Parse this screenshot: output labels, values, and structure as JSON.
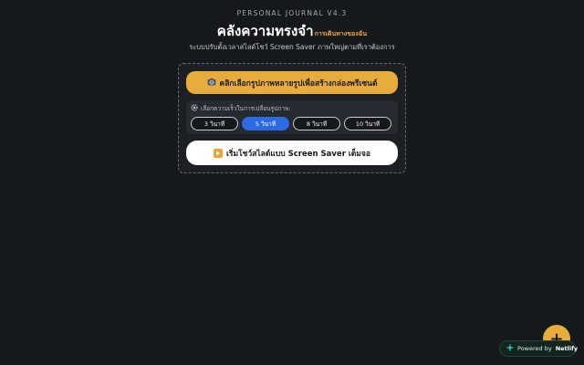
{
  "header": {
    "kicker": "PERSONAL JOURNAL V4.3",
    "title": "คลังความทรงจำ",
    "title_sub": "การเดินทางของฉัน",
    "description": "ระบบปรับตั้งเวลาสไลด์โชว์ Screen Saver ภาพใหญ่ตามที่เราต้องการ"
  },
  "panel": {
    "pick_button": {
      "icon": "camera-icon",
      "label": "คลิกเลือกรูปภาพหลายรูปเพื่อสร้างกล่องพรีเซนต์"
    },
    "speed": {
      "icon": "gear-icon",
      "label": "เลือกความเร็วในการเปลี่ยนรูปภาพ:",
      "options": [
        "3 วินาที",
        "5 วินาที",
        "8 วินาที",
        "10 วินาที"
      ],
      "selected": "5 วินาที"
    },
    "start_button": {
      "icon": "play-icon",
      "label": "เริ่มโชว์สไลด์แบบ Screen Saver เต็มจอ"
    }
  },
  "fab": {
    "label": "+"
  },
  "netlify": {
    "prefix": "Powered by",
    "brand": "Netlify"
  },
  "colors": {
    "background": "#16191c",
    "accent": "#e8ac3c",
    "selected": "#2d6be4"
  }
}
